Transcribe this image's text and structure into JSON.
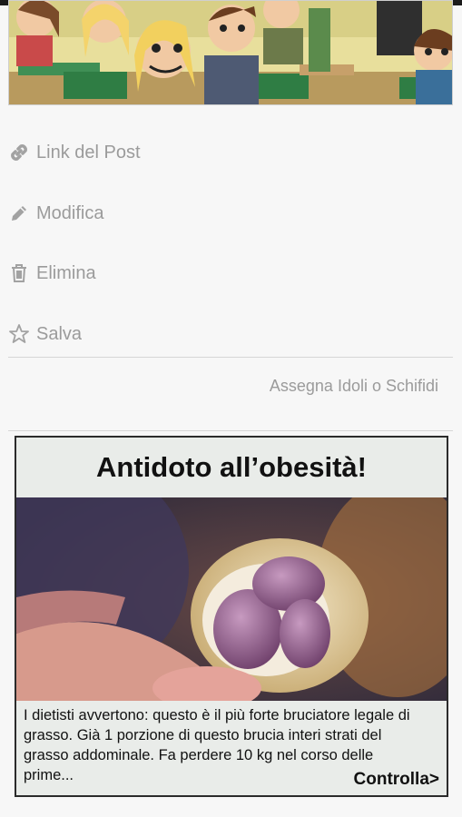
{
  "actions": [
    {
      "label": "Link del Post",
      "icon": "link-icon"
    },
    {
      "label": "Modifica",
      "icon": "pencil-icon"
    },
    {
      "label": "Elimina",
      "icon": "trash-icon"
    },
    {
      "label": "Salva",
      "icon": "star-icon"
    }
  ],
  "assign_label": "Assegna Idoli o Schifidi",
  "ad": {
    "title": "Antidoto all’obesità!",
    "text": "I dietisti avvertono: questo è il più forte bruciatore legale di grasso. Già 1 porzione di questo brucia interi strati del grasso addominale. Fa perdere 10 kg nel corso delle prime...",
    "cta": "Controlla>"
  },
  "colors": {
    "action_text": "#9b9b9b",
    "background": "#f7f7f7",
    "divider": "#d6d6d6"
  }
}
